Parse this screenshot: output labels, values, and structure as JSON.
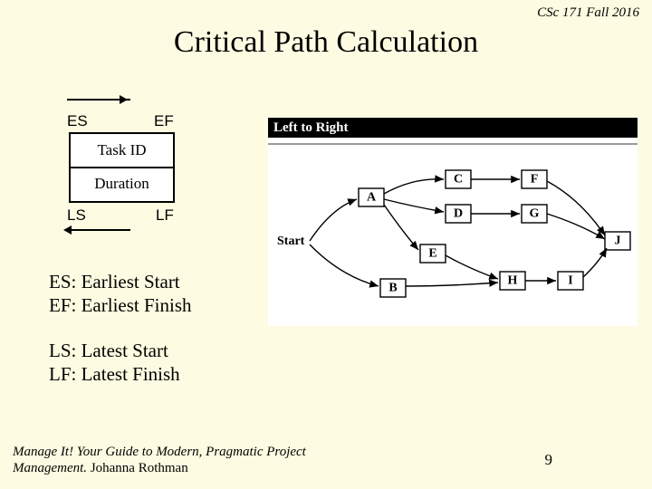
{
  "header": "CSc 171 Fall 2016",
  "title": "Critical Path Calculation",
  "taskbox": {
    "es": "ES",
    "ef": "EF",
    "ls": "LS",
    "lf": "LF",
    "id": "Task ID",
    "dur": "Duration"
  },
  "diagram": {
    "banner": "Left to Right",
    "start": "Start",
    "nodes": [
      "A",
      "B",
      "C",
      "D",
      "E",
      "F",
      "G",
      "H",
      "I",
      "J"
    ]
  },
  "defs": {
    "es": "ES: Earliest Start",
    "ef": "EF: Earliest Finish",
    "ls": "LS: Latest Start",
    "lf": "LF: Latest Finish"
  },
  "footer": {
    "book": "Manage It! Your Guide to Modern, Pragmatic Project Management.",
    "author": " Johanna Rothman",
    "page": "9"
  }
}
